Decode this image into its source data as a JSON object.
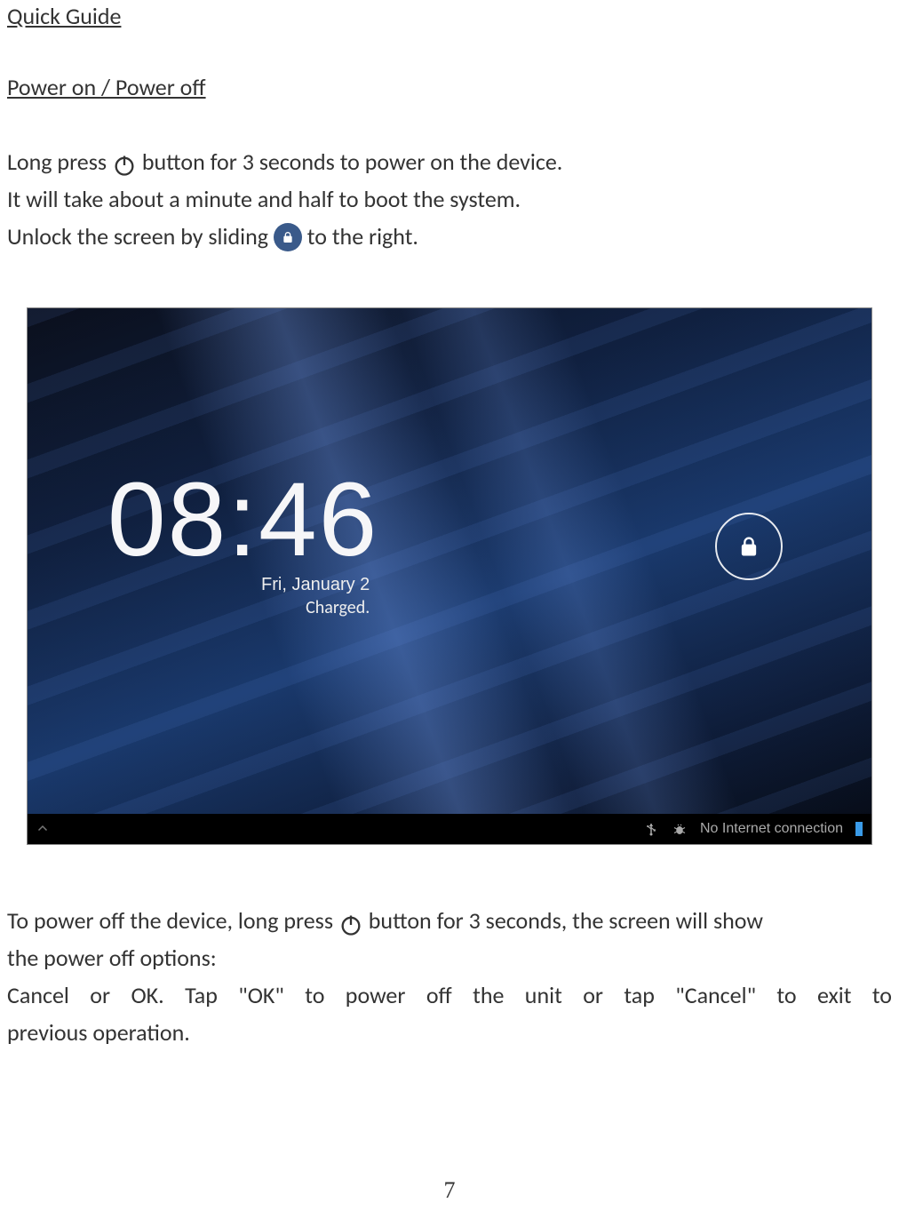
{
  "doc": {
    "guide_title": "Quick Guide",
    "section_title": "Power on / Power off",
    "para1_a": "Long press ",
    "para1_b": " button for 3 seconds to power on the device.",
    "para2": "It will take about a minute and half to boot the system.",
    "para3_a": "Unlock the screen by sliding ",
    "para3_b": " to the right.",
    "below1_a": "To power off the device, long press ",
    "below1_b": " button for 3 seconds, the screen will show",
    "below2": "the power off options:",
    "below3": "Cancel  or  OK.   Tap \"OK\" to power off the unit or tap \"Cancel\" to exit to",
    "below4": "previous operation.",
    "page_number": "7"
  },
  "lockscreen": {
    "time": "08:46",
    "date": "Fri, January 2",
    "battery": "Charged.",
    "status_text": "No Internet connection"
  }
}
